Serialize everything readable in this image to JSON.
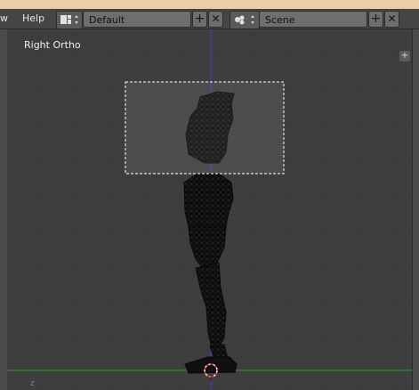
{
  "menubar": {
    "view_fragment": "w",
    "help_label": "Help",
    "layout_value": "Default",
    "scene_value": "Scene",
    "add_symbol": "+",
    "close_symbol": "✕"
  },
  "viewport": {
    "view_label": "Right Ortho",
    "toolshelf_toggle": "+",
    "axis_indicator": "z"
  },
  "colors": {
    "grid_background": "#3d3d3d",
    "z_axis": "#3b3bd6",
    "y_axis": "#2f9a2f",
    "mesh": "#0c0c0c",
    "selection_box": "#ffffff"
  }
}
